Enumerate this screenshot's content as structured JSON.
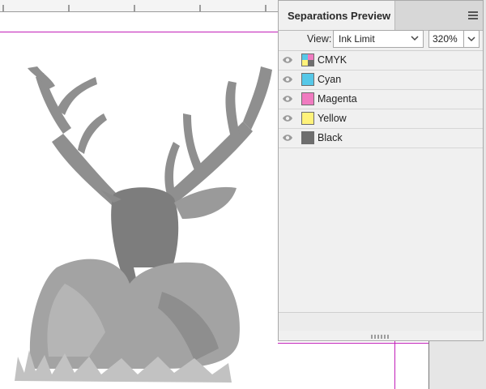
{
  "panel": {
    "title": "Separations Preview",
    "view_label": "View:",
    "view_value": "Ink Limit",
    "ink_limit": "320%",
    "separations": [
      {
        "name": "CMYK",
        "color": "cmyk",
        "icon": "eye-icon"
      },
      {
        "name": "Cyan",
        "color": "#56c8e8",
        "icon": "eye-icon"
      },
      {
        "name": "Magenta",
        "color": "#f07bc0",
        "icon": "eye-icon"
      },
      {
        "name": "Yellow",
        "color": "#fff27a",
        "icon": "eye-icon"
      },
      {
        "name": "Black",
        "color": "#6e6e6e",
        "icon": "eye-icon"
      }
    ]
  },
  "colors": {
    "guide": "#c21fb8",
    "panel_bg": "#f0f0f0",
    "artwork_gray": "#a3a3a3"
  }
}
